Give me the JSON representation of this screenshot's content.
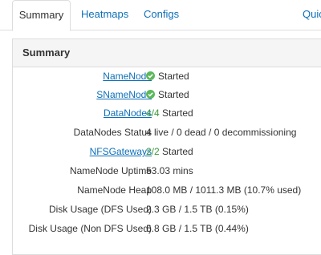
{
  "tabs": [
    {
      "label": "Summary",
      "active": true
    },
    {
      "label": "Heatmaps",
      "active": false
    },
    {
      "label": "Configs",
      "active": false
    },
    {
      "label": "Quic",
      "active": false
    }
  ],
  "panel": {
    "title": "Summary",
    "rows": [
      {
        "label": "NameNode",
        "label_link": true,
        "icon": "check-circle-icon",
        "value": "Started"
      },
      {
        "label": "SNameNode",
        "label_link": true,
        "icon": "check-circle-icon",
        "value": "Started"
      },
      {
        "label": "DataNodes",
        "label_link": true,
        "value_highlight": "4/4",
        "value": "Started"
      },
      {
        "label": "DataNodes Status",
        "label_link": false,
        "value": "4 live / 0 dead / 0 decommissioning"
      },
      {
        "label": "NFSGateways",
        "label_link": true,
        "value_highlight": "2/2",
        "value": "Started"
      },
      {
        "label": "NameNode Uptime",
        "label_link": false,
        "value": "53.03 mins"
      },
      {
        "label": "NameNode Heap",
        "label_link": false,
        "value": "108.0 MB / 1011.3 MB (10.7% used)"
      },
      {
        "label": "Disk Usage (DFS Used)",
        "label_link": false,
        "value": "2.3 GB / 1.5 TB (0.15%)"
      },
      {
        "label": "Disk Usage (Non DFS Used)",
        "label_link": false,
        "value": "6.8 GB / 1.5 TB (0.44%)"
      }
    ]
  },
  "colors": {
    "link": "#0d6fb8",
    "success": "#5cb85c",
    "highlight": "#3c9a3c"
  }
}
